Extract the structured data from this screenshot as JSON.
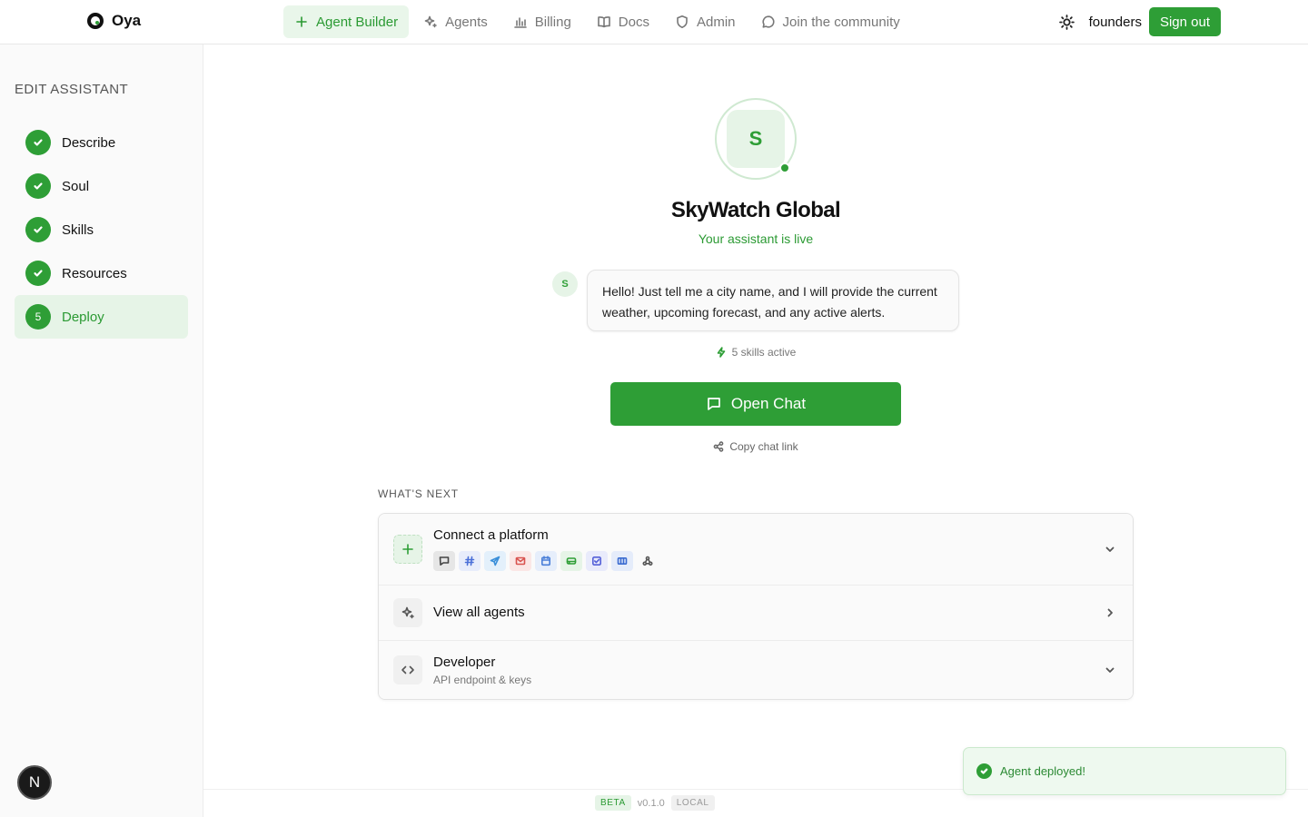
{
  "brand": {
    "name": "Oya"
  },
  "nav": {
    "items": [
      {
        "label": "Agent Builder",
        "icon": "plus-icon",
        "active": true
      },
      {
        "label": "Agents",
        "icon": "sparkles-icon"
      },
      {
        "label": "Billing",
        "icon": "bar-chart-icon"
      },
      {
        "label": "Docs",
        "icon": "book-icon"
      },
      {
        "label": "Admin",
        "icon": "shield-icon"
      },
      {
        "label": "Join the community",
        "icon": "chat-bubble-icon"
      }
    ]
  },
  "header": {
    "username": "founders",
    "signout_label": "Sign out",
    "theme_icon": "sun-icon"
  },
  "sidebar": {
    "title": "EDIT ASSISTANT",
    "steps": [
      {
        "label": "Describe",
        "state": "done"
      },
      {
        "label": "Soul",
        "state": "done"
      },
      {
        "label": "Skills",
        "state": "done"
      },
      {
        "label": "Resources",
        "state": "done"
      },
      {
        "label": "Deploy",
        "state": "current",
        "number": "5"
      }
    ]
  },
  "agent": {
    "initial": "S",
    "name": "SkyWatch Global",
    "status": "Your assistant is live",
    "greeting": "Hello! Just tell me a city name, and I will provide the current weather, upcoming forecast, and any active alerts.",
    "skills_text": "5 skills active",
    "open_chat_label": "Open Chat",
    "copy_link_label": "Copy chat link"
  },
  "whats_next": {
    "title": "WHAT'S NEXT",
    "rows": [
      {
        "title": "Connect a platform",
        "icon": "plus-icon"
      },
      {
        "title": "View all agents",
        "icon": "sparkles-icon"
      },
      {
        "title": "Developer",
        "subtitle": "API endpoint & keys",
        "icon": "code-icon"
      }
    ],
    "platforms": [
      {
        "icon": "chat-icon",
        "color": "#444444",
        "bg": "#e6e6e6"
      },
      {
        "icon": "hash-icon",
        "color": "#4a6fd8",
        "bg": "#e8edfb"
      },
      {
        "icon": "send-icon",
        "color": "#3a8fd9",
        "bg": "#e3f0fb"
      },
      {
        "icon": "mail-icon",
        "color": "#d9534f",
        "bg": "#fbe7e6"
      },
      {
        "icon": "calendar-icon",
        "color": "#4a7fd8",
        "bg": "#e6eefb"
      },
      {
        "icon": "drive-icon",
        "color": "#2e9e36",
        "bg": "#e6f4e7"
      },
      {
        "icon": "checkbox-icon",
        "color": "#5561d8",
        "bg": "#e9ebfb"
      },
      {
        "icon": "ticket-icon",
        "color": "#3a6bd0",
        "bg": "#e5ecfa"
      },
      {
        "icon": "webhook-icon",
        "color": "#555555",
        "bg": "transparent"
      }
    ]
  },
  "footer": {
    "beta": "BETA",
    "version": "v0.1.0",
    "env": "LOCAL"
  },
  "toast": {
    "text": "Agent deployed!"
  },
  "n_badge": "N",
  "colors": {
    "accent": "#2e9e36",
    "accent_light": "#e6f4e7"
  }
}
